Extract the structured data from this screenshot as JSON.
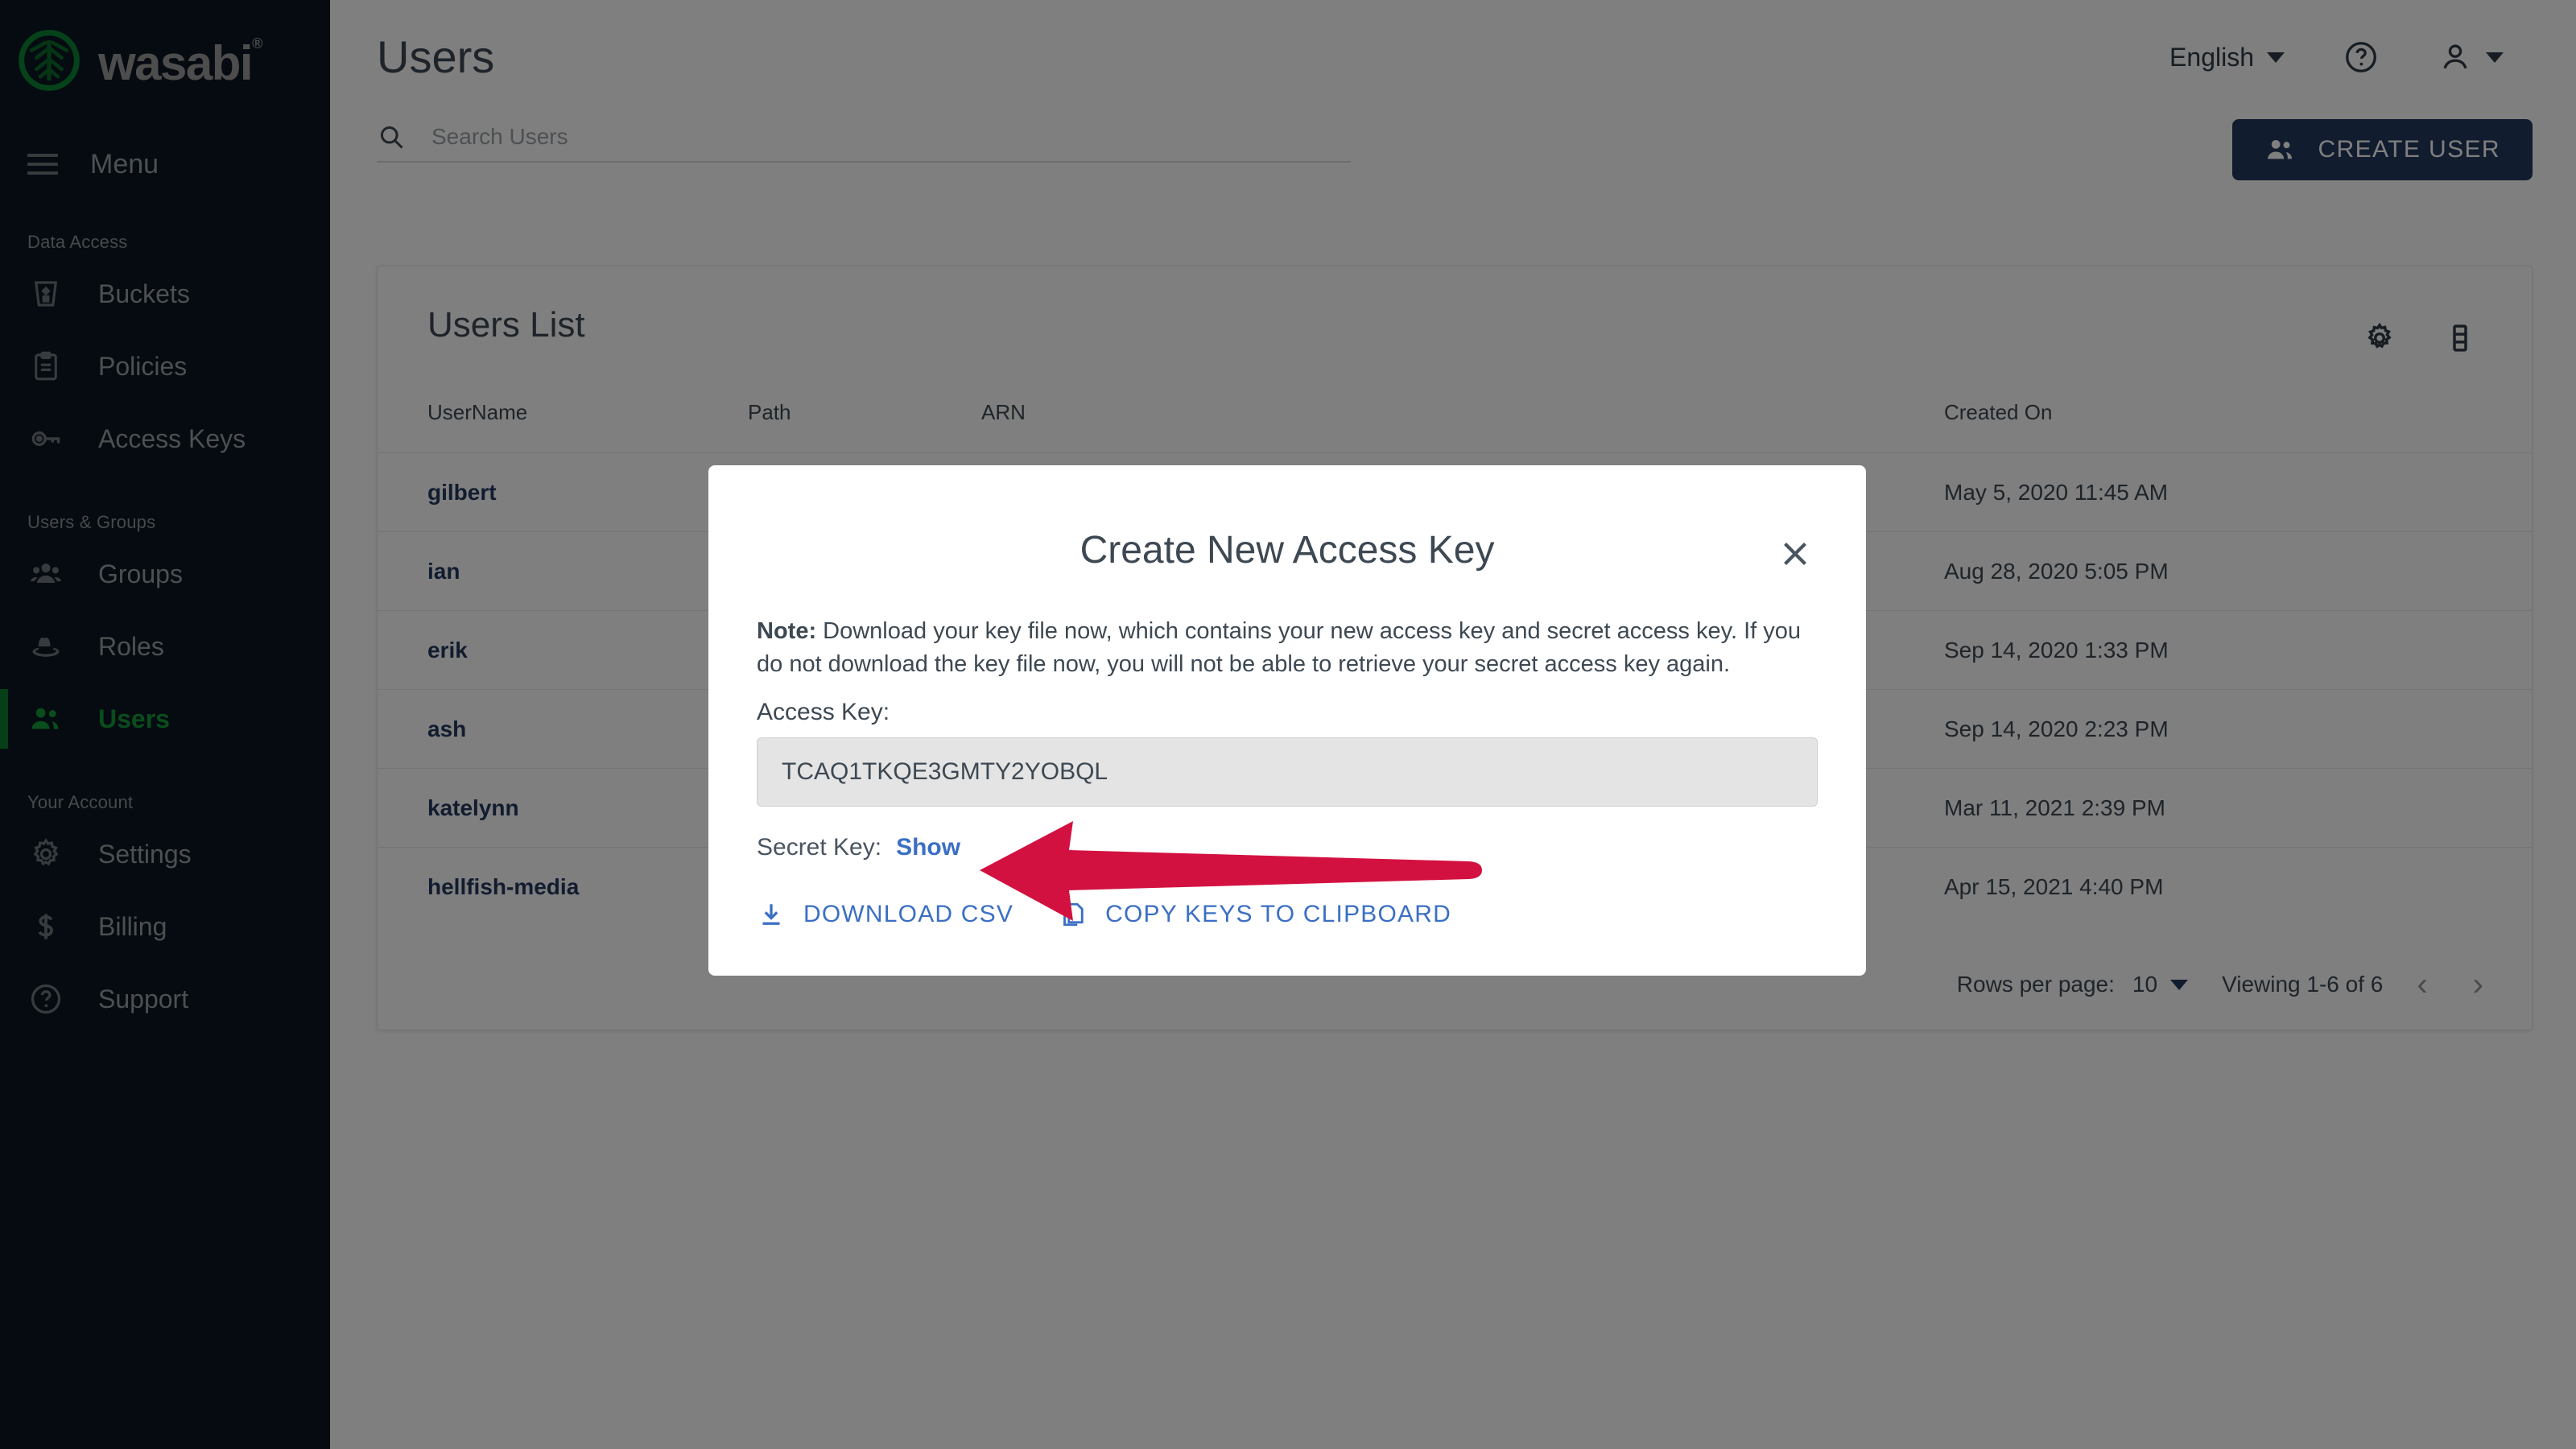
{
  "sidebar": {
    "brand": "wasabi",
    "brand_mark": "wasabi-leaf-logo",
    "registered_mark": "®",
    "menu_label": "Menu",
    "menu_icon": "hamburger-icon",
    "sections": [
      {
        "title": "Data Access",
        "items": [
          {
            "label": "Buckets",
            "icon": "bucket-icon",
            "active": false
          },
          {
            "label": "Policies",
            "icon": "clipboard-icon",
            "active": false
          },
          {
            "label": "Access Keys",
            "icon": "key-icon",
            "active": false
          }
        ]
      },
      {
        "title": "Users & Groups",
        "items": [
          {
            "label": "Groups",
            "icon": "groups-icon",
            "active": false
          },
          {
            "label": "Roles",
            "icon": "hat-icon",
            "active": false
          },
          {
            "label": "Users",
            "icon": "users-icon",
            "active": true
          }
        ]
      },
      {
        "title": "Your Account",
        "items": [
          {
            "label": "Settings",
            "icon": "gear-icon",
            "active": false
          },
          {
            "label": "Billing",
            "icon": "dollar-icon",
            "active": false
          },
          {
            "label": "Support",
            "icon": "question-circle-icon",
            "active": false
          }
        ]
      }
    ],
    "active_color": "#149b3b"
  },
  "header": {
    "title": "Users",
    "search": {
      "placeholder": "Search Users",
      "value": "",
      "icon": "search-icon"
    },
    "language": {
      "label": "English",
      "icon": "chevron-down-icon"
    },
    "help_icon": "question-circle-icon",
    "account_icon": "person-icon",
    "account_caret_icon": "chevron-down-icon",
    "create_user": {
      "label": "CREATE USER",
      "icon": "add-users-icon",
      "color": "#25395e"
    }
  },
  "card": {
    "title": "Users List",
    "settings_icon": "gear-icon",
    "columns_icon": "columns-icon",
    "columns": [
      "UserName",
      "Path",
      "ARN",
      "Created On"
    ],
    "rows": [
      {
        "username": "gilbert",
        "path": "",
        "arn": "",
        "created_on": "May 5, 2020 11:45 AM"
      },
      {
        "username": "ian",
        "path": "",
        "arn": "",
        "created_on": "Aug 28, 2020 5:05 PM"
      },
      {
        "username": "erik",
        "path": "",
        "arn": "",
        "created_on": "Sep 14, 2020 1:33 PM"
      },
      {
        "username": "ash",
        "path": "",
        "arn": "",
        "created_on": "Sep 14, 2020 2:23 PM"
      },
      {
        "username": "katelynn",
        "path": "",
        "arn": "",
        "created_on": "Mar 11, 2021 2:39 PM"
      },
      {
        "username": "hellfish-media",
        "path": "",
        "arn": "",
        "created_on": "Apr 15, 2021 4:40 PM"
      }
    ],
    "pagination": {
      "rows_per_page_label": "Rows per page:",
      "rows_per_page_value": "10",
      "rows_per_page_caret": "chevron-down-icon",
      "viewing": "Viewing 1-6 of 6",
      "prev_icon": "chevron-left-icon",
      "next_icon": "chevron-right-icon"
    }
  },
  "modal": {
    "title": "Create New Access Key",
    "close_icon": "close-icon",
    "note_prefix": "Note:",
    "note_body": " Download your key file now, which contains your new access key and secret access key. If you do not download the key file now, you will not be able to retrieve your secret access key again.",
    "access_key_label": "Access Key:",
    "access_key_value": "TCAQ1TKQE3GMTY2YOBQL",
    "secret_key_label": "Secret Key:",
    "secret_key_show": "Show",
    "download_csv": {
      "label": "DOWNLOAD CSV",
      "icon": "download-icon"
    },
    "copy_clipboard": {
      "label": "COPY KEYS TO CLIPBOARD",
      "icon": "copy-icon"
    },
    "link_color": "#3b6fc4"
  },
  "annotation": {
    "arrow_icon": "red-arrow-left",
    "color": "#d31140",
    "points_at": "Show"
  }
}
